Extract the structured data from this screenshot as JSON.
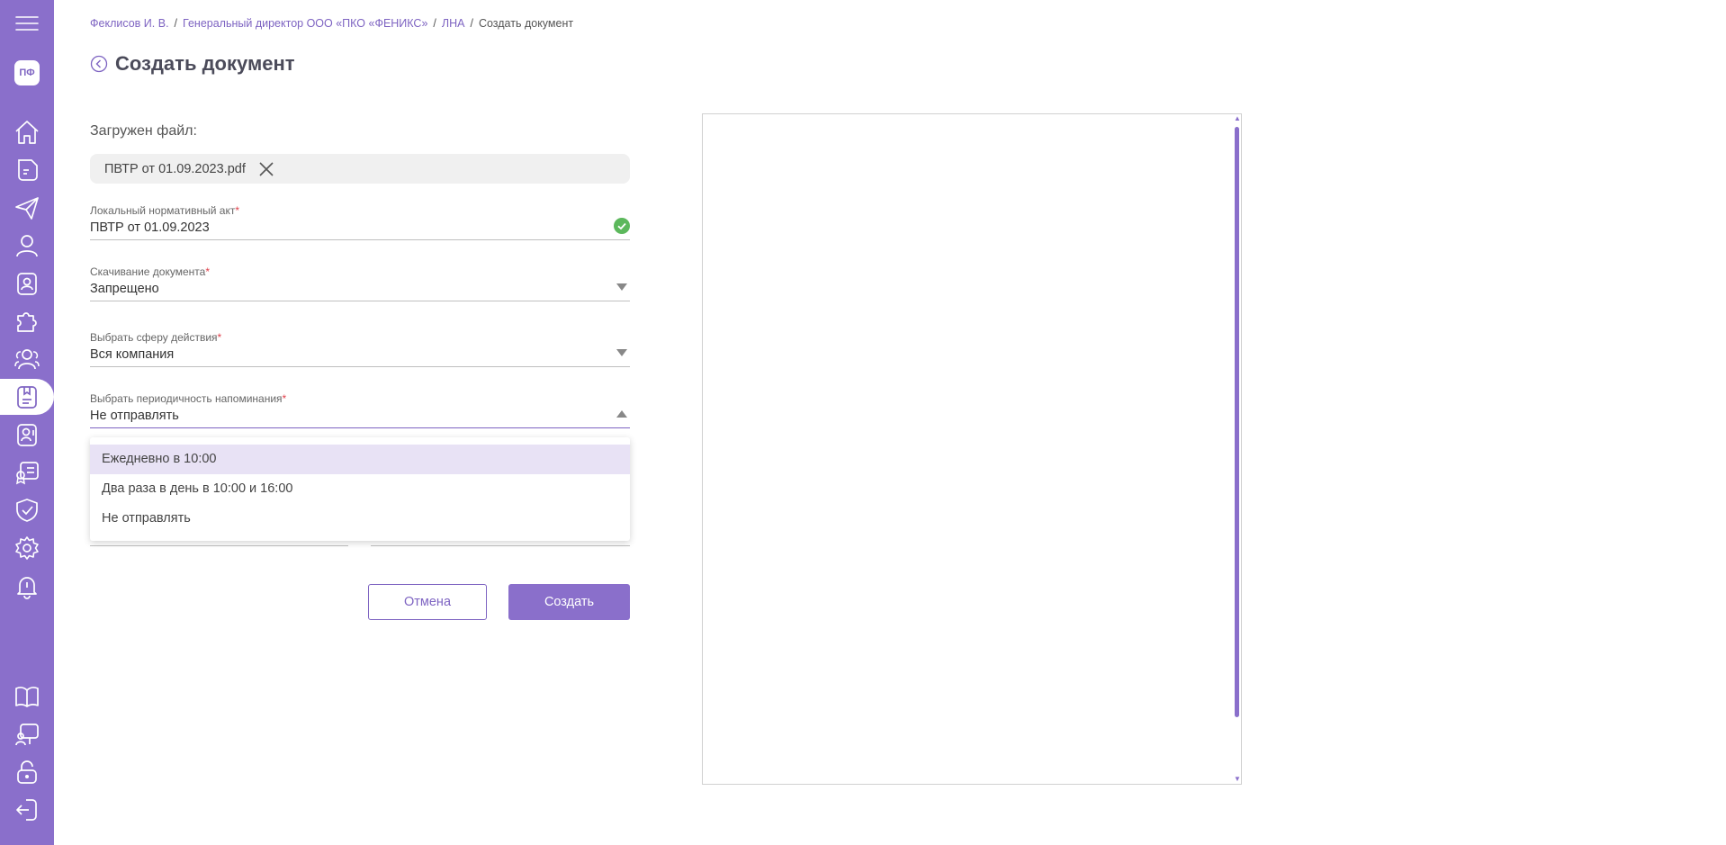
{
  "sidebar": {
    "avatar": "ПФ",
    "colors": {
      "background": "#8a6fcb",
      "icon": "#ffffff",
      "active_icon": "#7e64c2"
    },
    "items": [
      {
        "name": "menu-icon"
      },
      {
        "name": "home-icon"
      },
      {
        "name": "document-icon"
      },
      {
        "name": "send-icon"
      },
      {
        "name": "user-icon"
      },
      {
        "name": "badge-icon"
      },
      {
        "name": "puzzle-icon"
      },
      {
        "name": "users-icon"
      },
      {
        "name": "local-acts-icon",
        "active": true
      },
      {
        "name": "contact-icon"
      },
      {
        "name": "certificate-icon"
      },
      {
        "name": "shield-icon"
      },
      {
        "name": "gear-icon"
      },
      {
        "name": "bell-icon"
      },
      {
        "name": "book-icon"
      },
      {
        "name": "presentation-icon"
      },
      {
        "name": "lock-icon"
      },
      {
        "name": "logout-icon"
      }
    ]
  },
  "breadcrumb": {
    "items": [
      "Феклисов И. В.",
      "Генеральный директор ООО «ПКО «ФЕНИКС»",
      "ЛНА"
    ],
    "separator": "/",
    "current": "Создать документ"
  },
  "page": {
    "title": "Создать документ"
  },
  "form": {
    "file_label": "Загружен файл:",
    "file_name": "ПВТР от 01.09.2023.pdf",
    "fields": {
      "act": {
        "label": "Локальный нормативный акт",
        "required": "*",
        "value": "ПВТР от 01.09.2023"
      },
      "download": {
        "label": "Скачивание документа",
        "required": "*",
        "value": "Запрещено"
      },
      "scope": {
        "label": "Выбрать сферу действия",
        "required": "*",
        "value": "Вся компания"
      },
      "reminder": {
        "label": "Выбрать периодичность напоминания",
        "required": "*",
        "value": "Не отправлять"
      }
    },
    "dropdown_options": [
      "Ежедневно в 10:00",
      "Два раза в день в 10:00 и 16:00",
      "Не отправлять"
    ],
    "cancel": "Отмена",
    "create": "Создать"
  },
  "colors": {
    "accent": "#8a6fcb",
    "link": "#7e64c2",
    "success": "#5cb85c",
    "required": "#e0414c"
  }
}
